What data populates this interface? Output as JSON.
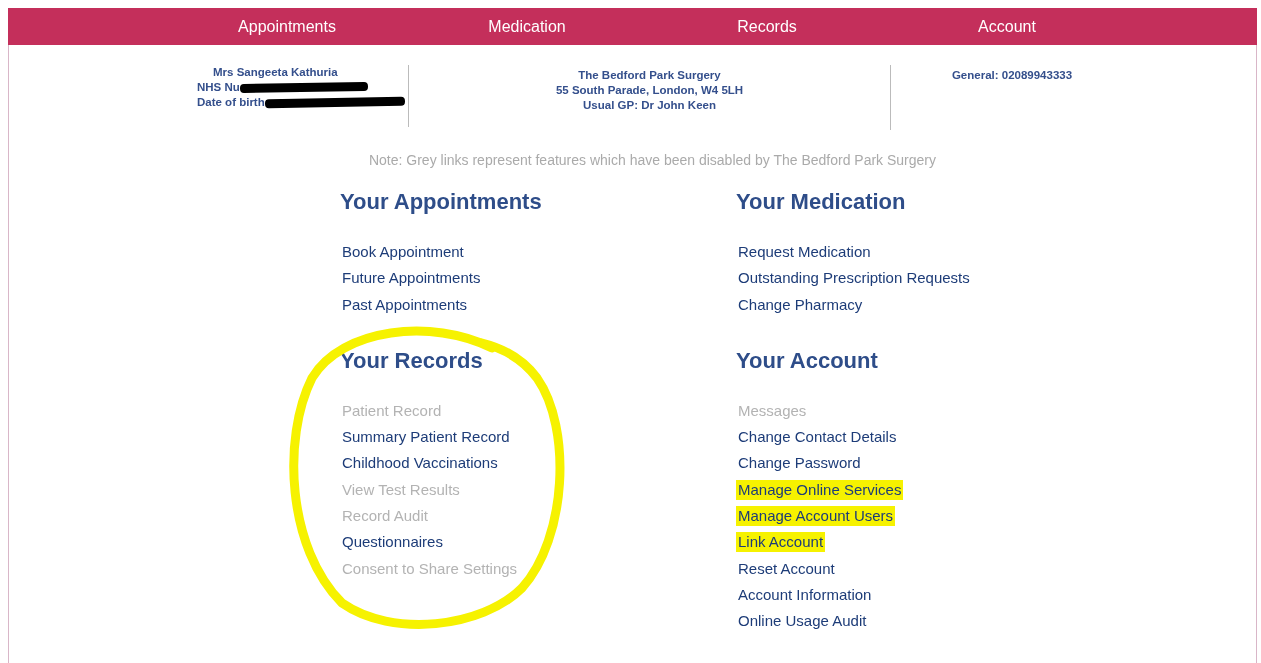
{
  "nav": [
    {
      "label": "Appointments"
    },
    {
      "label": "Medication"
    },
    {
      "label": "Records"
    },
    {
      "label": "Account"
    }
  ],
  "patient": [
    {
      "text": "Mrs Sangeeta Kathuria",
      "redacted": false
    },
    {
      "text": "NHS Nu",
      "redacted": true
    },
    {
      "text": "Date of birth",
      "redacted": true
    }
  ],
  "practice": [
    "The Bedford Park Surgery",
    "55 South Parade, London, W4 5LH",
    "Usual GP: Dr John Keen"
  ],
  "contact": [
    "General: 02089943333"
  ],
  "note": "Note: Grey links represent features which have been disabled by The Bedford Park Surgery",
  "sections": [
    {
      "title": "Your Appointments",
      "circled": false,
      "links": [
        {
          "label": "Book Appointment",
          "disabled": false,
          "highlighted": false
        },
        {
          "label": "Future Appointments",
          "disabled": false,
          "highlighted": false
        },
        {
          "label": "Past Appointments",
          "disabled": false,
          "highlighted": false
        }
      ]
    },
    {
      "title": "Your Medication",
      "circled": false,
      "links": [
        {
          "label": "Request Medication",
          "disabled": false,
          "highlighted": false
        },
        {
          "label": "Outstanding Prescription Requests",
          "disabled": false,
          "highlighted": false
        },
        {
          "label": "Change Pharmacy",
          "disabled": false,
          "highlighted": false
        }
      ]
    },
    {
      "title": "Your Records",
      "circled": true,
      "links": [
        {
          "label": "Patient Record",
          "disabled": true,
          "highlighted": false
        },
        {
          "label": "Summary Patient Record",
          "disabled": false,
          "highlighted": false
        },
        {
          "label": "Childhood Vaccinations",
          "disabled": false,
          "highlighted": false
        },
        {
          "label": "View Test Results",
          "disabled": true,
          "highlighted": false
        },
        {
          "label": "Record Audit",
          "disabled": true,
          "highlighted": false
        },
        {
          "label": "Questionnaires",
          "disabled": false,
          "highlighted": false
        },
        {
          "label": "Consent to Share Settings",
          "disabled": true,
          "highlighted": false
        }
      ]
    },
    {
      "title": "Your Account",
      "circled": false,
      "links": [
        {
          "label": "Messages",
          "disabled": true,
          "highlighted": false
        },
        {
          "label": "Change Contact Details",
          "disabled": false,
          "highlighted": false
        },
        {
          "label": "Change Password",
          "disabled": false,
          "highlighted": false
        },
        {
          "label": "Manage Online Services",
          "disabled": false,
          "highlighted": true
        },
        {
          "label": "Manage Account Users",
          "disabled": false,
          "highlighted": true
        },
        {
          "label": "Link Account",
          "disabled": false,
          "highlighted": true
        },
        {
          "label": "Reset Account",
          "disabled": false,
          "highlighted": false
        },
        {
          "label": "Account Information",
          "disabled": false,
          "highlighted": false
        },
        {
          "label": "Online Usage Audit",
          "disabled": false,
          "highlighted": false
        }
      ]
    }
  ]
}
